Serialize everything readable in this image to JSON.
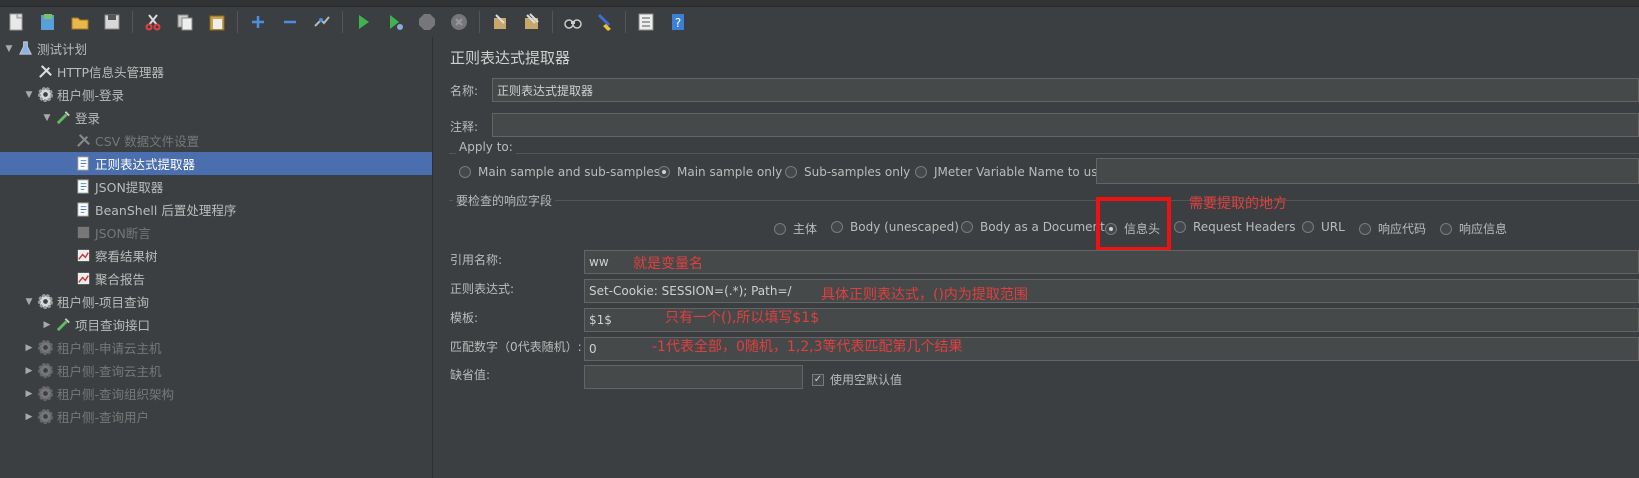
{
  "tree": {
    "items": [
      {
        "label": "测试计划"
      },
      {
        "label": "HTTP信息头管理器"
      },
      {
        "label": "租户侧-登录"
      },
      {
        "label": "登录"
      },
      {
        "label": "CSV 数据文件设置"
      },
      {
        "label": "正则表达式提取器"
      },
      {
        "label": "JSON提取器"
      },
      {
        "label": "BeanShell 后置处理程序"
      },
      {
        "label": "JSON断言"
      },
      {
        "label": "察看结果树"
      },
      {
        "label": "聚合报告"
      },
      {
        "label": "租户侧-项目查询"
      },
      {
        "label": "项目查询接口"
      },
      {
        "label": "租户侧-申请云主机"
      },
      {
        "label": "租户侧-查询云主机"
      },
      {
        "label": "租户侧-查询组织架构"
      },
      {
        "label": "租户侧-查询用户"
      }
    ]
  },
  "panel": {
    "title": "正则表达式提取器",
    "name_label": "名称:",
    "name_value": "正则表达式提取器",
    "comment_label": "注释:",
    "comment_value": "",
    "apply_to": {
      "legend": "Apply to:",
      "options": [
        "Main sample and sub-samples",
        "Main sample only",
        "Sub-samples only",
        "JMeter Variable Name to use"
      ],
      "selected": "Main sample only",
      "var_value": ""
    },
    "field_check": {
      "legend": "要检查的响应字段",
      "options": [
        "主体",
        "Body (unescaped)",
        "Body as a Document",
        "信息头",
        "Request Headers",
        "URL",
        "响应代码",
        "响应信息"
      ],
      "selected": "信息头"
    },
    "ref_name_label": "引用名称:",
    "ref_name_value": "ww",
    "regex_label": "正则表达式:",
    "regex_value": "Set-Cookie: SESSION=(.*); Path=/",
    "template_label": "模板:",
    "template_value": "$1$",
    "match_no_label": "匹配数字（0代表随机）:",
    "match_no_value": "0",
    "default_label": "缺省值:",
    "default_value": "",
    "use_empty_label": "使用空默认值",
    "use_empty_checked": true
  },
  "annotations": {
    "extract_here": "需要提取的地方",
    "var_name": "就是变量名",
    "regex_note": "具体正则表达式，()内为提取范围",
    "template_note": "只有一个(),所以填写$1$",
    "match_note": "-1代表全部，0随机，1,2,3等代表匹配第几个结果"
  },
  "colors": {
    "background": "#3c3f41",
    "selection": "#4b6eaf",
    "annotation": "#e0403d",
    "highlight_box": "#ee1111"
  }
}
